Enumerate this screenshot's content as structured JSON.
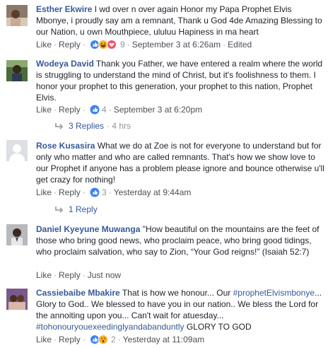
{
  "comments": [
    {
      "author": "Esther Ekwire",
      "text": " I wd over n over again Honor my Papa Prophet Elvis Mbonye, i proudly say am a remnant, Thank u God 4de Amazing Blessing to our Nation, u own Mouthpiece, ululuu Hapiness in ma heart",
      "like_label": "Like",
      "reply_label": "Reply",
      "reactions": [
        "like",
        "haha",
        "love"
      ],
      "reaction_count": "9",
      "timestamp": "September 3 at 6:26am",
      "edited": "Edited"
    },
    {
      "author": "Wodeya David",
      "text": " Thank you Father, we have entered a realm where the world is struggling to understand the mind of Christ, but it's foolishness to them. I honor your prophet to this generation, your prophet to this nation, Prophet Elvis.",
      "like_label": "Like",
      "reply_label": "Reply",
      "reactions": [
        "like"
      ],
      "reaction_count": "4",
      "timestamp": "September 3 at 6:20pm",
      "replies_label": "3 Replies",
      "replies_since": "· 4 hrs"
    },
    {
      "author": "Rose Kusasira",
      "text": " What we do at Zoe is not for everyone to understand but for only who matter and who are called remnants. That's how we show love to our Prophet if anyone has a problem please ignore and bounce otherwise u'll get crazy for nothing!",
      "like_label": "Like",
      "reply_label": "Reply",
      "reactions": [
        "like"
      ],
      "reaction_count": "3",
      "timestamp": "Yesterday at 9:44am",
      "replies_label": "1 Reply"
    },
    {
      "author": "Daniel Kyeyune Muwanga",
      "text": " \"How beautiful on the mountains are the feet of those who bring good news, who proclaim peace, who bring good tidings, who proclaim salvation, who say to Zion, “Your God reigns!” (Isaiah 52:7)",
      "like_label": "Like",
      "reply_label": "Reply",
      "timestamp": "Just now"
    },
    {
      "author": "Cassiebaibe Mbakire",
      "text_parts": [
        {
          "t": " That is how we honour... Our ",
          "tag": false
        },
        {
          "t": "#prophetElvismbonye",
          "tag": true
        },
        {
          "t": "... Glory to God.. We blessed to have you in our nation.. We bless the Lord for the annoiting upon you... Can't wait for atuesday... ",
          "tag": false
        },
        {
          "t": "#tohonouryouexeedinglyandabanduntly",
          "tag": true
        },
        {
          "t": " GLORY TO GOD",
          "tag": false
        }
      ],
      "like_label": "Like",
      "reply_label": "Reply",
      "reactions": [
        "like",
        "wow"
      ],
      "reaction_count": "2",
      "timestamp": "Yesterday at 11:09am"
    }
  ],
  "colors": {
    "name": "#365899",
    "text": "#1d2129",
    "meta": "#90949c",
    "like_blue": "#4080ff",
    "love_red": "#f25268",
    "haha_yellow": "#f7b125"
  }
}
